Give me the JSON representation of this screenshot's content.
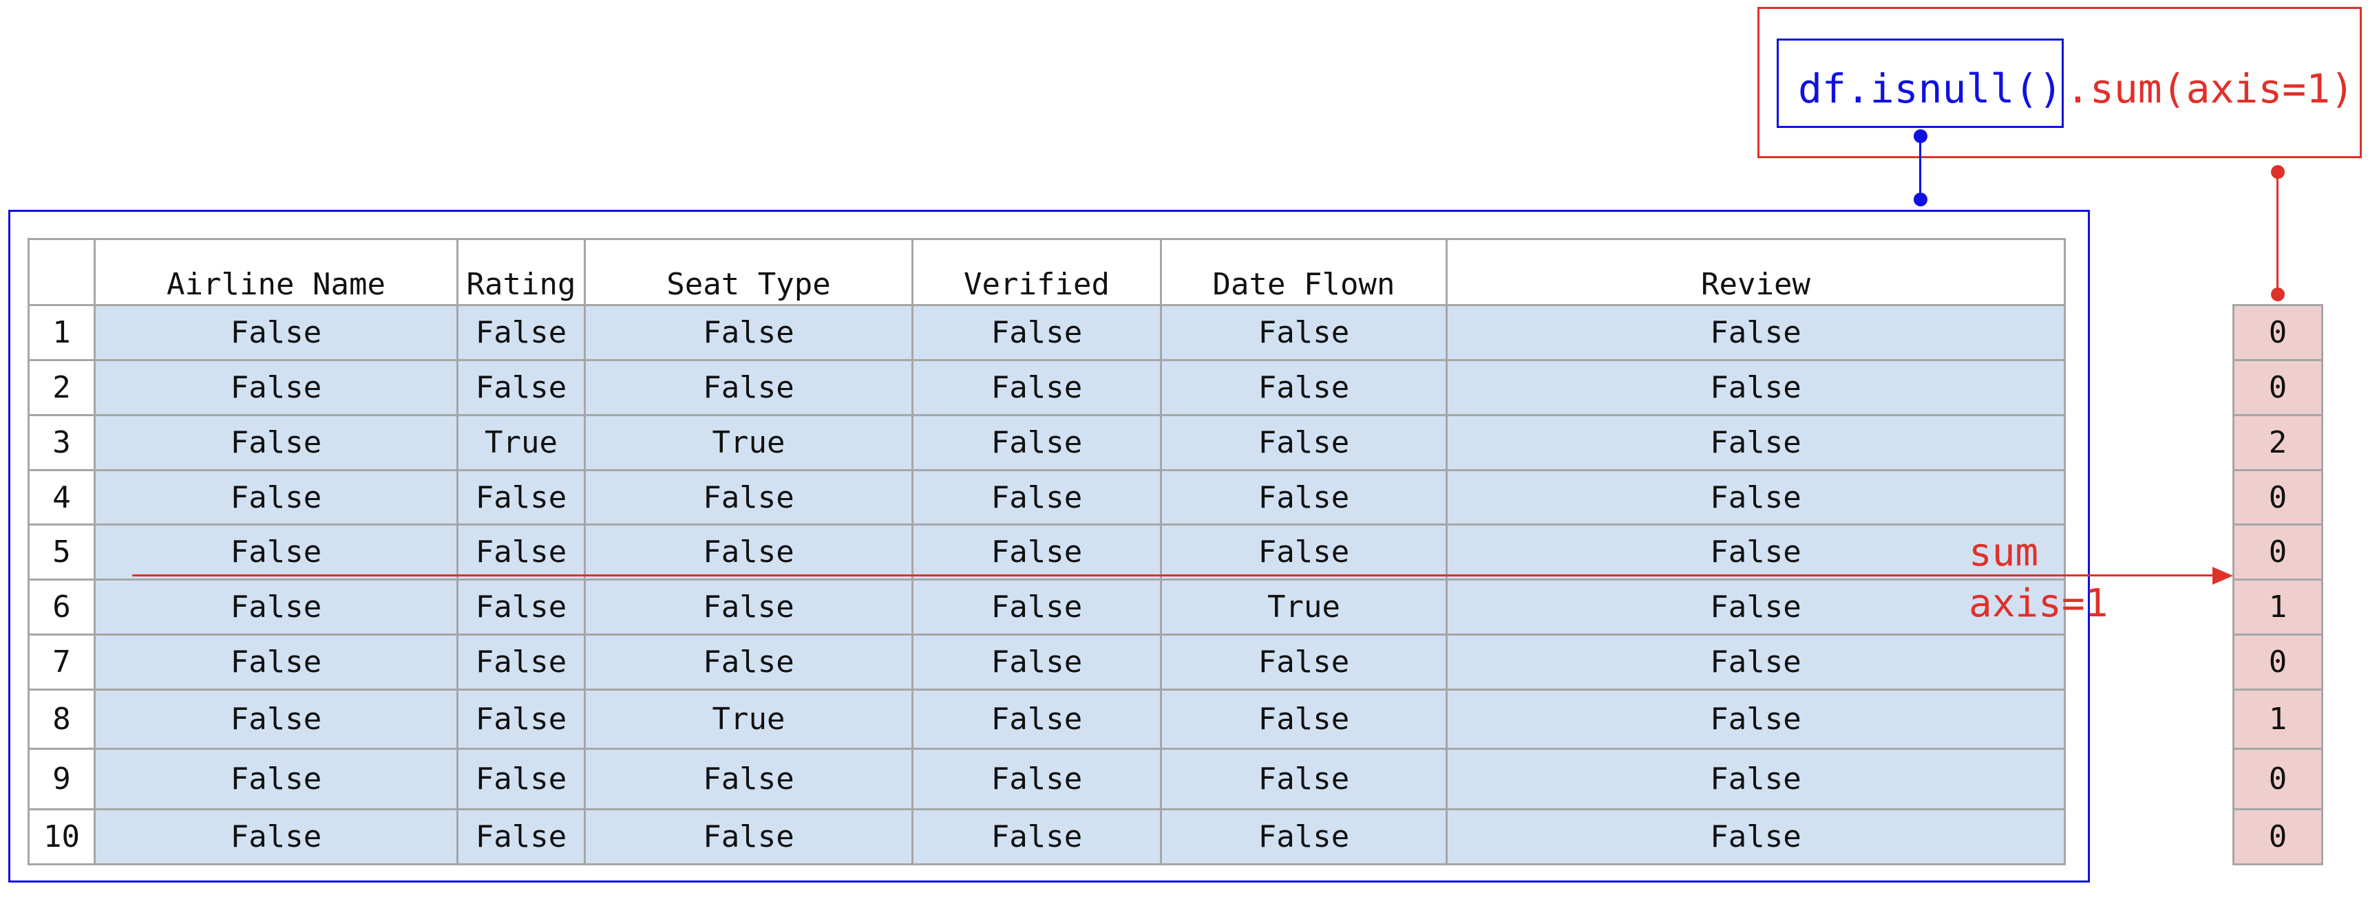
{
  "expression": {
    "isnull_part": "df.isnull()",
    "sum_part": ".sum(axis=1)"
  },
  "colors": {
    "isnull_accent": "#1010e0",
    "sum_accent": "#e0302a",
    "cell_fill": "#d2e1f2",
    "result_fill": "#efcfcd",
    "grid": "#a6a6a6"
  },
  "table": {
    "columns": [
      "Airline Name",
      "Rating",
      "Seat Type",
      "Verified",
      "Date Flown",
      "Review"
    ],
    "rows": [
      {
        "index": "1",
        "values": [
          "False",
          "False",
          "False",
          "False",
          "False",
          "False"
        ]
      },
      {
        "index": "2",
        "values": [
          "False",
          "False",
          "False",
          "False",
          "False",
          "False"
        ]
      },
      {
        "index": "3",
        "values": [
          "False",
          "True",
          "True",
          "False",
          "False",
          "False"
        ]
      },
      {
        "index": "4",
        "values": [
          "False",
          "False",
          "False",
          "False",
          "False",
          "False"
        ]
      },
      {
        "index": "5",
        "values": [
          "False",
          "False",
          "False",
          "False",
          "False",
          "False"
        ]
      },
      {
        "index": "6",
        "values": [
          "False",
          "False",
          "False",
          "False",
          "True",
          "False"
        ]
      },
      {
        "index": "7",
        "values": [
          "False",
          "False",
          "False",
          "False",
          "False",
          "False"
        ]
      },
      {
        "index": "8",
        "values": [
          "False",
          "False",
          "True",
          "False",
          "False",
          "False"
        ]
      },
      {
        "index": "9",
        "values": [
          "False",
          "False",
          "False",
          "False",
          "False",
          "False"
        ]
      },
      {
        "index": "10",
        "values": [
          "False",
          "False",
          "False",
          "False",
          "False",
          "False"
        ]
      }
    ]
  },
  "result": {
    "values": [
      "0",
      "0",
      "2",
      "0",
      "0",
      "1",
      "0",
      "1",
      "0",
      "0"
    ]
  },
  "annotation": {
    "line1": "sum",
    "line2": "axis=1"
  }
}
